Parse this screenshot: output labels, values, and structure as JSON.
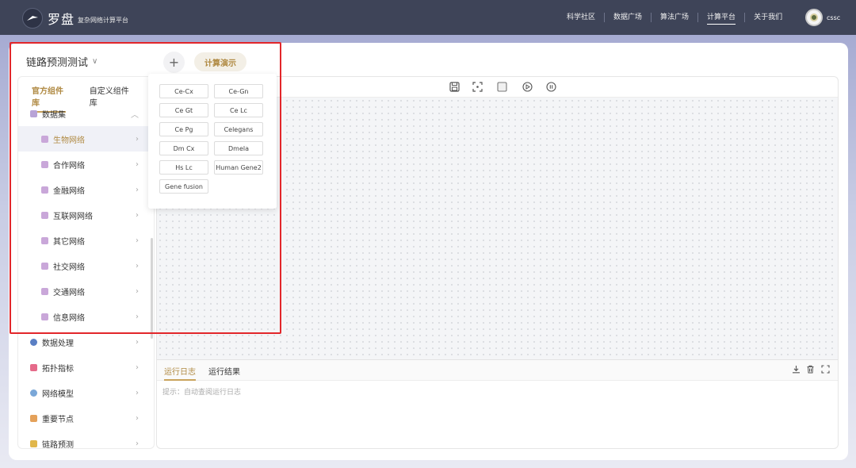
{
  "brand": {
    "name": "罗盘",
    "subtitle": "复杂网络计算平台"
  },
  "nav": {
    "items": [
      {
        "label": "科学社区",
        "active": false
      },
      {
        "label": "数据广场",
        "active": false
      },
      {
        "label": "算法广场",
        "active": false
      },
      {
        "label": "计算平台",
        "active": true
      },
      {
        "label": "关于我们",
        "active": false
      }
    ]
  },
  "user": {
    "name": "cssc"
  },
  "project": {
    "title": "链路预测测试",
    "add_label": "+",
    "demo_label": "计算演示"
  },
  "tabs": {
    "official": "官方组件库",
    "custom": "自定义组件库"
  },
  "tree": {
    "dataset": "数据集",
    "subcategories": [
      "生物网络",
      "合作网络",
      "金融网络",
      "互联网网络",
      "其它网络",
      "社交网络",
      "交通网络",
      "信息网络"
    ],
    "selected": "生物网络",
    "others": [
      "数据处理",
      "拓扑指标",
      "网络模型",
      "重要节点",
      "链路预测"
    ]
  },
  "datasets": [
    "Ce-Cx",
    "Ce-Gn",
    "Ce Gt",
    "Ce Lc",
    "Ce Pg",
    "Celegans",
    "Dm Cx",
    "Dmela",
    "Hs Lc",
    "Human Gene2",
    "Gene fusion"
  ],
  "log": {
    "tab_log": "运行日志",
    "tab_result": "运行结果",
    "hint": "提示：自动查阅运行日志"
  },
  "colors": {
    "accent": "#b08a43",
    "topbar": "#3e4458",
    "highlight": "#e2262a"
  }
}
